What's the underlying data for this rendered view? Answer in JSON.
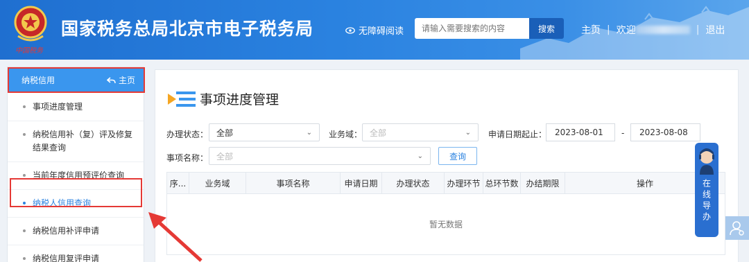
{
  "header": {
    "site_title": "国家税务总局北京市电子税务局",
    "emblem_text": "中国税务",
    "accessibility_label": "无障碍阅读",
    "search_placeholder": "请输入需要搜索的内容",
    "search_button": "搜索",
    "home_link": "主页",
    "welcome": "欢迎",
    "logout": "退出",
    "divider": "|"
  },
  "sidebar": {
    "title": "纳税信用",
    "home_label": "主页",
    "items": [
      {
        "label": "事项进度管理",
        "active": false
      },
      {
        "label": "纳税信用补（复）评及修复结果查询",
        "active": false
      },
      {
        "label": "当前年度信用预评价查询",
        "active": false
      },
      {
        "label": "纳税人信用查询",
        "active": true
      },
      {
        "label": "纳税信用补评申请",
        "active": false
      },
      {
        "label": "纳税信用复评申请",
        "active": false
      }
    ]
  },
  "main": {
    "page_title": "事项进度管理",
    "filters": {
      "status_label": "办理状态：",
      "status_value": "全部",
      "domain_label": "业务域：",
      "domain_placeholder": "全部",
      "date_label": "申请日期起止：",
      "date_from": "2023-08-01",
      "date_sep": "-",
      "date_to": "2023-08-08",
      "item_label": "事项名称：",
      "item_placeholder": "全部",
      "query_button": "查询"
    },
    "table": {
      "columns": [
        "序...",
        "业务域",
        "事项名称",
        "申请日期",
        "办理状态",
        "办理环节",
        "总环节数",
        "办结期限",
        "操作"
      ],
      "empty_text": "暂无数据"
    }
  },
  "floating": {
    "help_text": "在线导办"
  },
  "colors": {
    "header_blue": "#2a82e0",
    "accent": "#3a96ee",
    "highlight_red": "#e53935"
  }
}
